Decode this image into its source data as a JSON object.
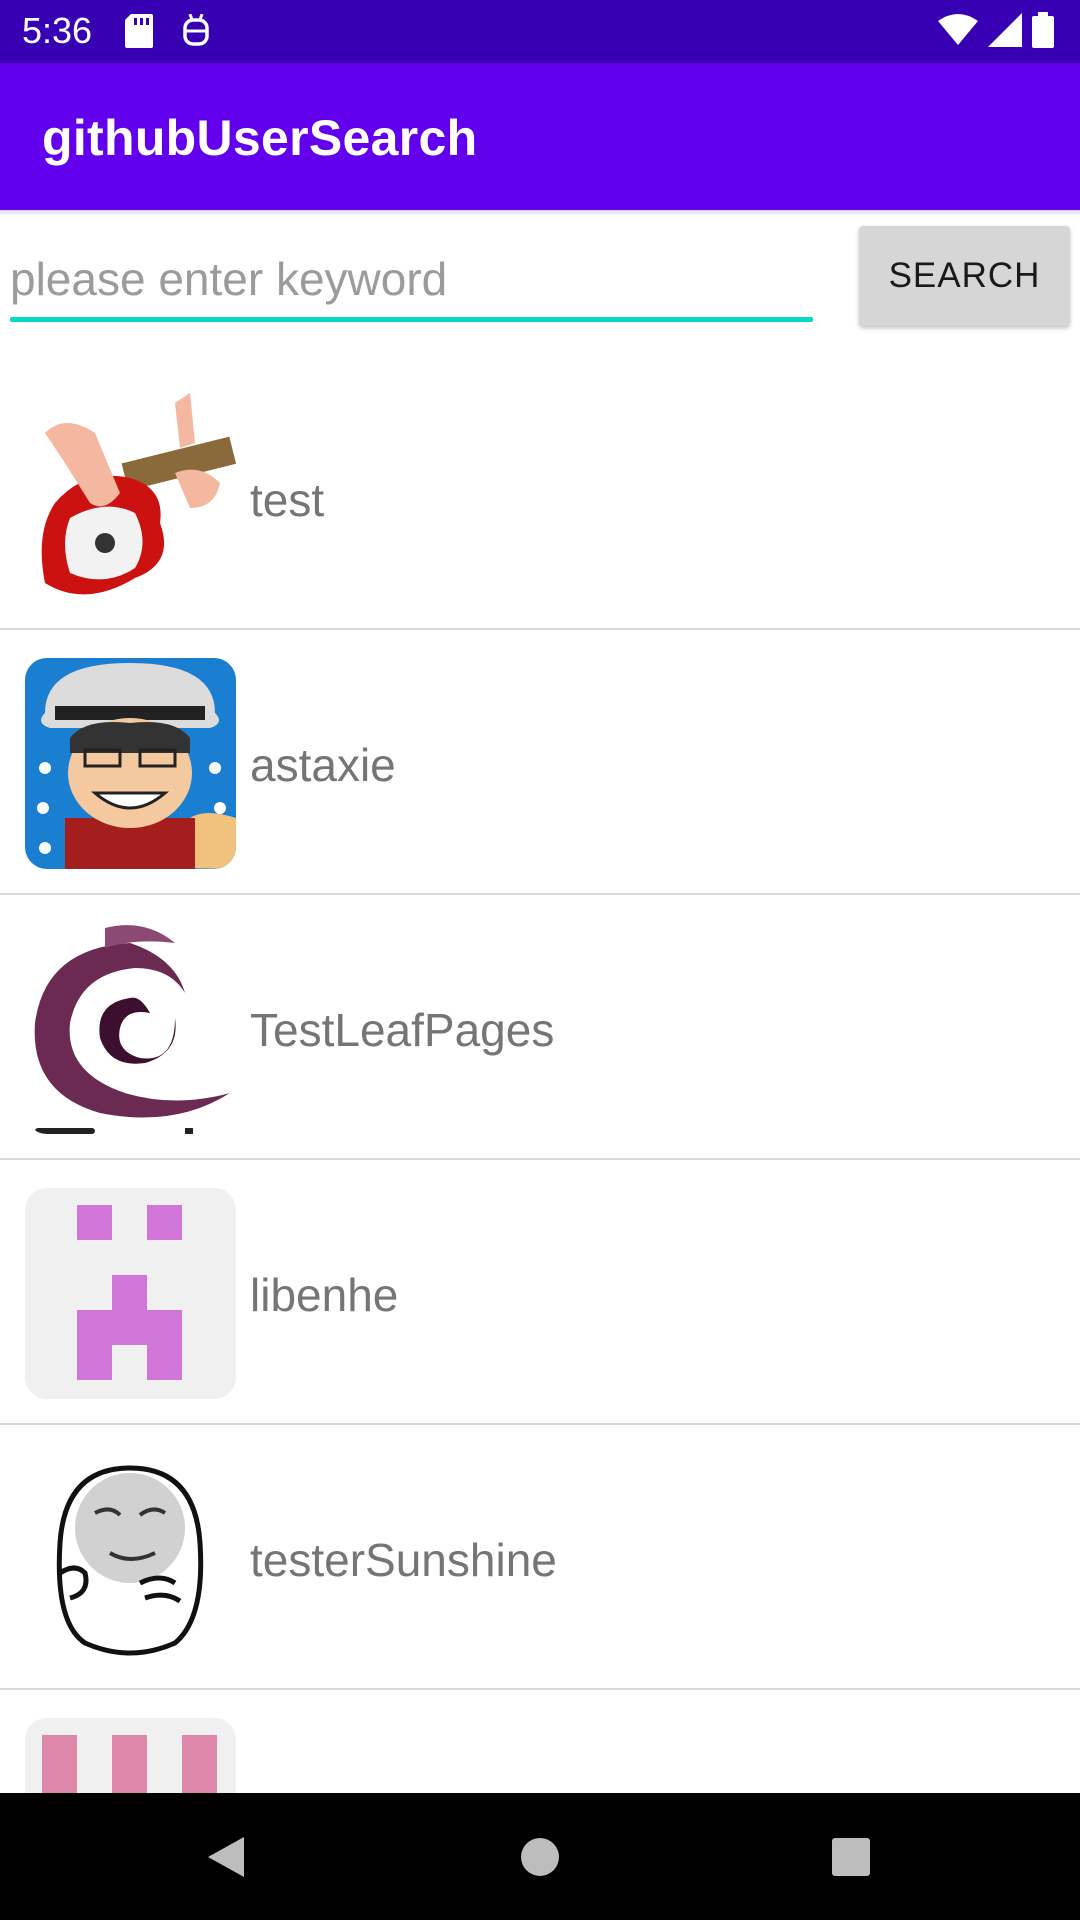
{
  "status_bar": {
    "time": "5:36",
    "left_icons": [
      "sd-card-icon",
      "android-debug-icon"
    ],
    "right_icons": [
      "wifi-icon",
      "signal-icon",
      "battery-icon"
    ]
  },
  "app_bar": {
    "title": "githubUserSearch"
  },
  "search": {
    "placeholder": "please enter keyword",
    "value": "",
    "button_label": "SEARCH"
  },
  "results": [
    {
      "username": "test",
      "avatar": "guitar-avatar"
    },
    {
      "username": "astaxie",
      "avatar": "cartoon-man-hat-avatar"
    },
    {
      "username": "TestLeafPages",
      "avatar": "purple-swirl-logo-avatar"
    },
    {
      "username": "libenhe",
      "avatar": "pink-identicon-avatar"
    },
    {
      "username": "testerSunshine",
      "avatar": "meme-face-avatar"
    },
    {
      "username": "",
      "avatar": "rose-identicon-avatar"
    }
  ],
  "nav_bar": {
    "buttons": [
      "back-icon",
      "home-icon",
      "recents-icon"
    ]
  },
  "colors": {
    "status_bar": "#3700b3",
    "app_bar": "#6200ee",
    "accent": "#03dac5",
    "button_bg": "#d6d6d6"
  }
}
